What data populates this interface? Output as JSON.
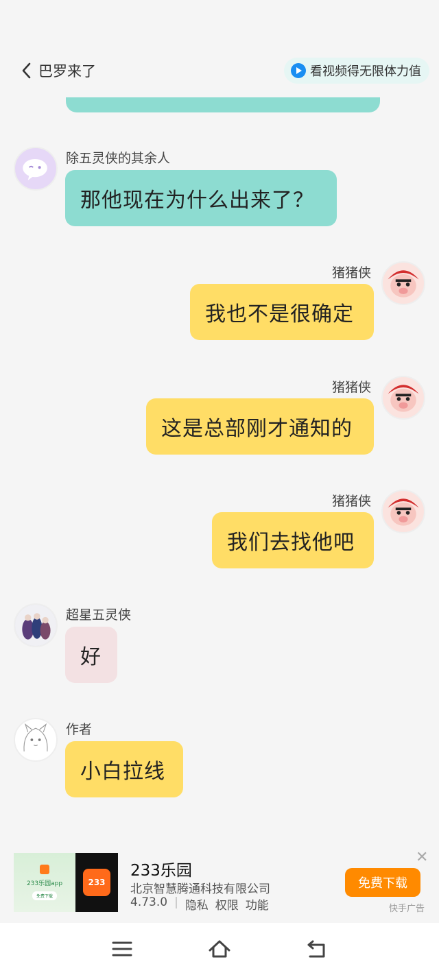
{
  "header": {
    "back_label": "巴罗来了",
    "video_pill": "看视频得无限体力值"
  },
  "messages": [
    {
      "side": "left",
      "name": "除五灵侠的其余人",
      "text": "那他现在为什么出来了？",
      "color": "#8ddcd1",
      "avatar": "ghost-avatar"
    },
    {
      "side": "right",
      "name": "猪猪侠",
      "text": "我也不是很确定",
      "color": "#ffdd66",
      "avatar": "pig-hero-avatar"
    },
    {
      "side": "right",
      "name": "猪猪侠",
      "text": "这是总部刚才通知的",
      "color": "#ffdd66",
      "avatar": "pig-hero-avatar"
    },
    {
      "side": "right",
      "name": "猪猪侠",
      "text": "我们去找他吧",
      "color": "#ffdd66",
      "avatar": "pig-hero-avatar"
    },
    {
      "side": "left",
      "name": "超星五灵侠",
      "text": "好",
      "color": "#f3e1e3",
      "avatar": "group-photo-avatar"
    },
    {
      "side": "left",
      "name": "作者",
      "text": "小白拉线",
      "color": "#ffdd66",
      "avatar": "sketch-avatar"
    }
  ],
  "ad": {
    "thumb_left_title": "233乐园app",
    "thumb_left_button": "免费下载",
    "thumb_right_icon": "233",
    "title": "233乐园",
    "company": "北京智慧腾通科技有限公司",
    "version": "4.73.0",
    "privacy": "隐私",
    "permissions": "权限",
    "features": "功能",
    "download_button": "免费下载",
    "ad_label": "快手广告",
    "close": "✕"
  },
  "navbar": {
    "icons": [
      "menu-icon",
      "home-icon",
      "back-icon"
    ]
  },
  "colors": {
    "teal": "#8ddcd1",
    "yellow": "#ffdd66",
    "pink": "#f3e1e3",
    "download": "#ff8a00",
    "play": "#1a8ef2"
  }
}
